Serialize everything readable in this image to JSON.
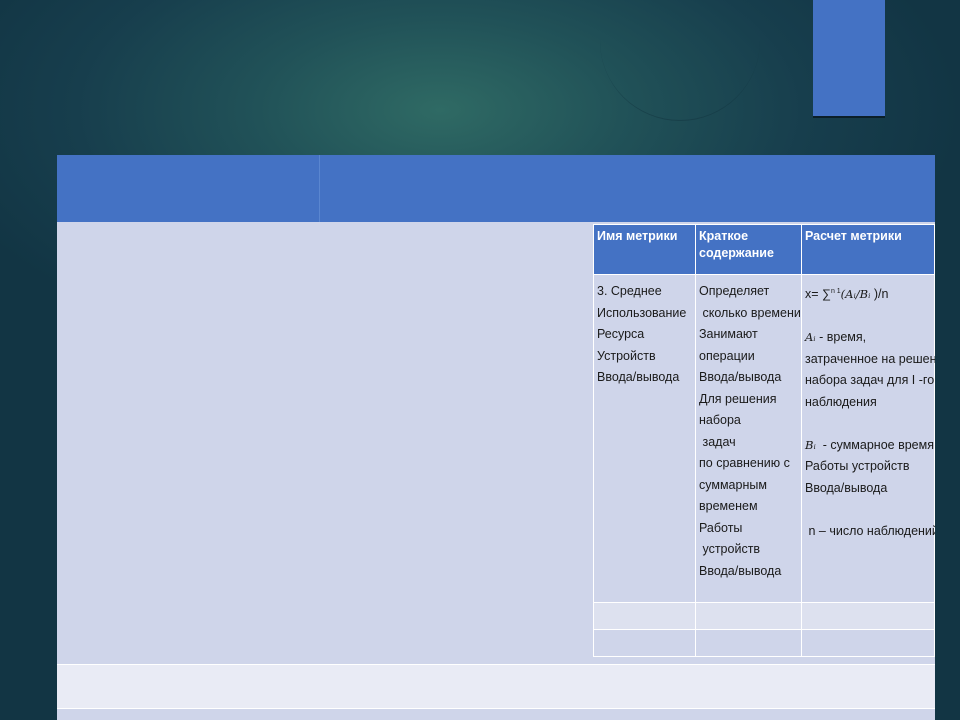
{
  "table": {
    "headers": [
      "Имя метрики",
      "Краткое содержание",
      "Расчет метрики"
    ],
    "metric_name_lines": [
      "3. Среднее",
      "Использование",
      "Ресурса",
      "Устройств",
      "Ввода/вывода"
    ],
    "summary_lines": [
      "Определяет",
      " сколько времени",
      "Занимают",
      "операции",
      "Ввода/вывода",
      "Для решения",
      "набора",
      " задач",
      "по сравнению с",
      "суммарным",
      "временем",
      "Работы",
      " устройств",
      "Ввода/вывода"
    ],
    "calc": {
      "formula_prefix": "x= ∑",
      "formula_limits": "n 1",
      "formula_body": "(Aᵢ/Bᵢ",
      "formula_suffix": " )/n",
      "a_symbol": "Aᵢ",
      "a_desc_first": " - время,",
      "a_desc_lines": [
        "затраченное на решение",
        "набора задач для I -го",
        "наблюдения"
      ],
      "b_symbol": "Bᵢ",
      "b_desc_first": "  - суммарное время",
      "b_desc_lines": [
        "Работы устройств",
        "Ввода/вывода"
      ],
      "n_desc": " n – число наблюдений"
    }
  },
  "colors": {
    "accent": "#4472c4",
    "body_fill": "#cfd5ea",
    "light_row": "#e9ebf5",
    "background": "#173e4d"
  }
}
